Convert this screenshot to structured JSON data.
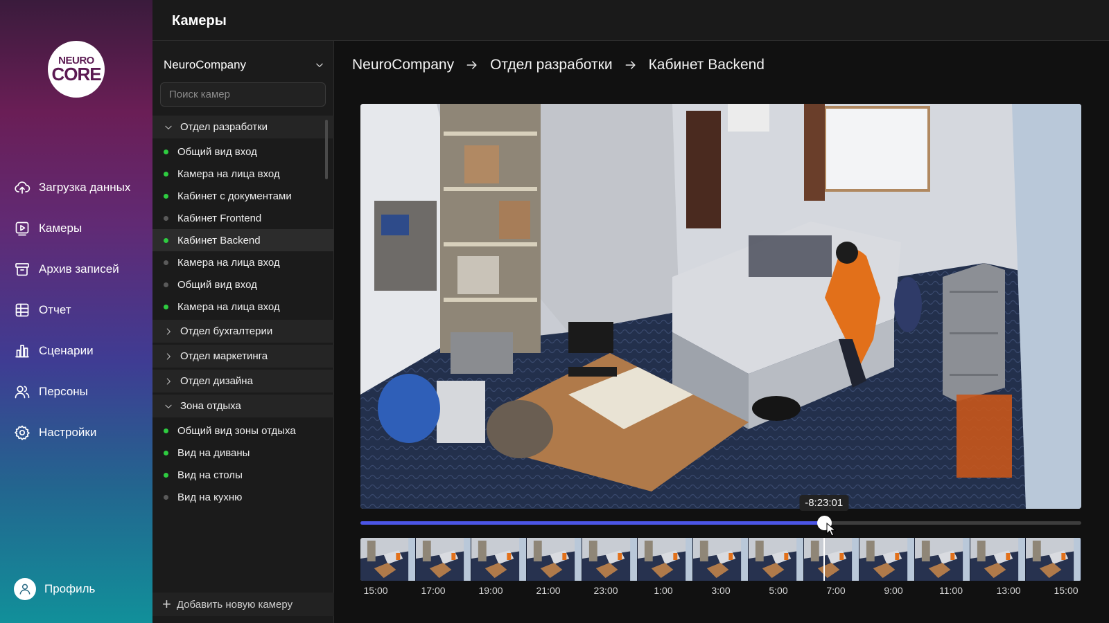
{
  "logo": {
    "line1": "NEURO",
    "line2": "CORE"
  },
  "nav": {
    "items": [
      {
        "label": "Загрузка данных",
        "icon": "cloud-upload-icon"
      },
      {
        "label": "Камеры",
        "icon": "camera-play-icon"
      },
      {
        "label": "Архив записей",
        "icon": "archive-box-icon"
      },
      {
        "label": "Отчет",
        "icon": "table-grid-icon"
      },
      {
        "label": "Сценарии",
        "icon": "bar-chart-icon"
      },
      {
        "label": "Персоны",
        "icon": "users-icon"
      },
      {
        "label": "Настройки",
        "icon": "gear-icon"
      }
    ],
    "profile": "Профиль"
  },
  "header": {
    "title": "Камеры"
  },
  "panel": {
    "company": "NeuroCompany",
    "search_placeholder": "Поиск камер",
    "add_camera": "Добавить новую камеру",
    "groups": [
      {
        "name": "Отдел разработки",
        "expanded": true,
        "cameras": [
          {
            "name": "Общий вид вход",
            "online": true
          },
          {
            "name": "Камера на лица вход",
            "online": true
          },
          {
            "name": "Кабинет с документами",
            "online": true
          },
          {
            "name": "Кабинет Frontend",
            "online": false
          },
          {
            "name": "Кабинет Backend",
            "online": true,
            "selected": true
          },
          {
            "name": "Камера на лица вход",
            "online": false
          },
          {
            "name": "Общий вид вход",
            "online": false
          },
          {
            "name": "Камера на лица вход",
            "online": true
          }
        ]
      },
      {
        "name": "Отдел бухгалтерии",
        "expanded": false,
        "cameras": []
      },
      {
        "name": "Отдел маркетинга",
        "expanded": false,
        "cameras": []
      },
      {
        "name": "Отдел дизайна",
        "expanded": false,
        "cameras": []
      },
      {
        "name": "Зона отдыха",
        "expanded": true,
        "cameras": [
          {
            "name": "Общий вид зоны отдыха",
            "online": true
          },
          {
            "name": "Вид на диваны",
            "online": true
          },
          {
            "name": "Вид на столы",
            "online": true
          },
          {
            "name": "Вид на кухню",
            "online": false
          }
        ]
      }
    ]
  },
  "breadcrumbs": [
    "NeuroCompany",
    "Отдел разработки",
    "Кабинет Backend"
  ],
  "player": {
    "time_tooltip": "-8:23:01",
    "progress_fraction": 0.643,
    "timeline_ticks": [
      "15:00",
      "17:00",
      "19:00",
      "21:00",
      "23:00",
      "1:00",
      "3:00",
      "5:00",
      "7:00",
      "9:00",
      "11:00",
      "13:00",
      "15:00"
    ],
    "thumbnail_count": 13
  },
  "colors": {
    "online": "#2ecc40",
    "offline": "#5a5a5a",
    "accent": "#4b55e6"
  }
}
